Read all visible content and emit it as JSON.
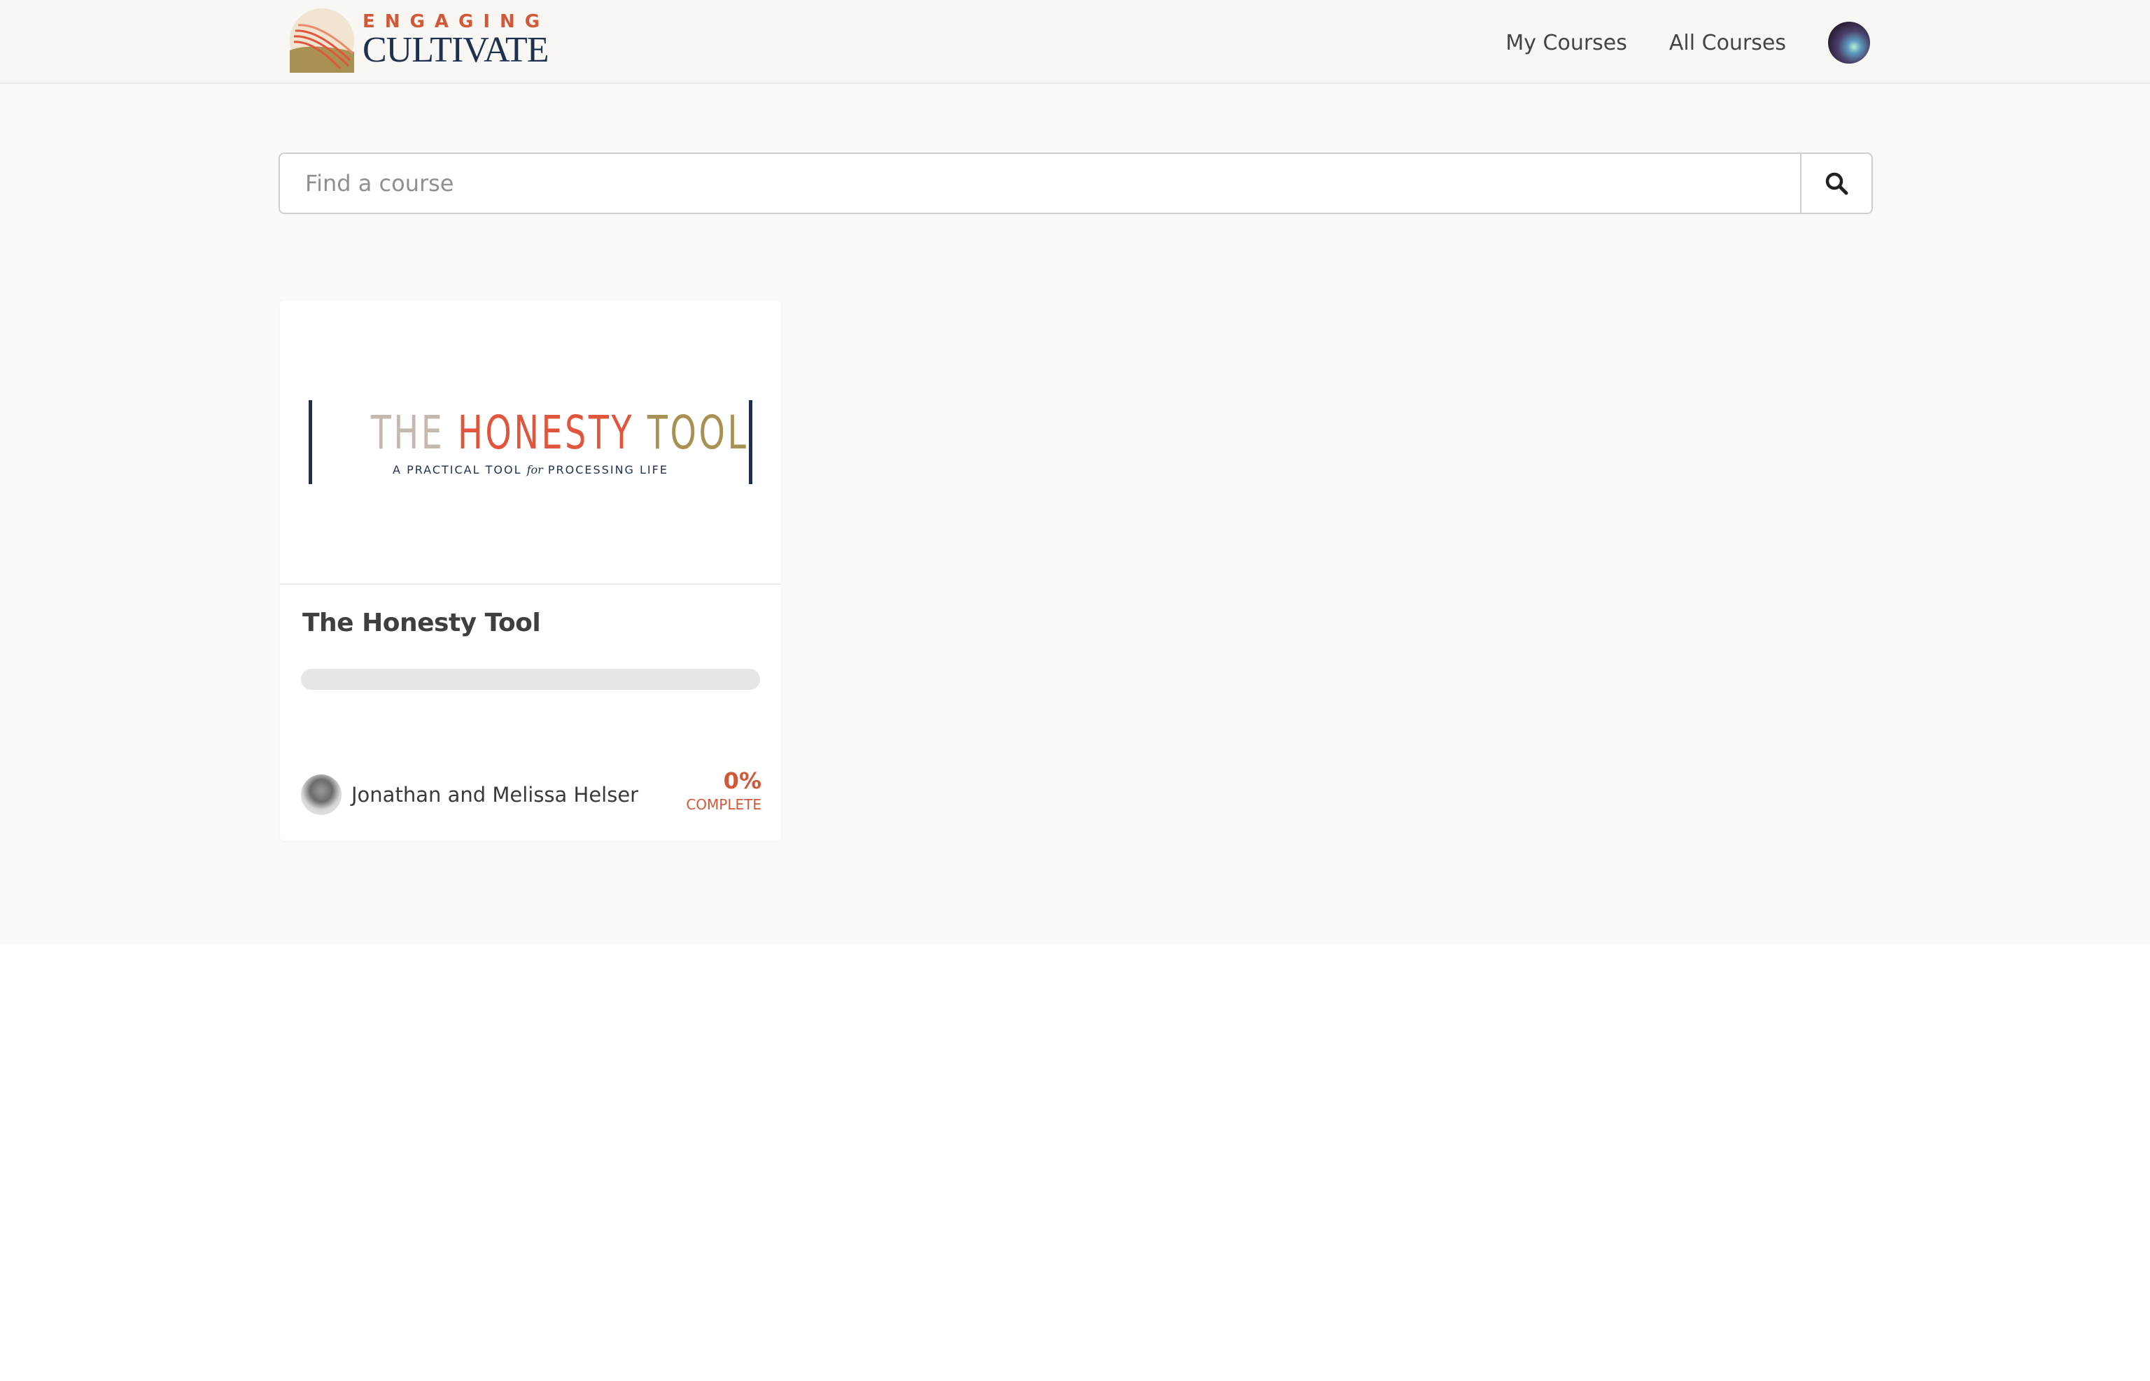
{
  "brand": {
    "name_top": "ENGAGING",
    "name_bottom": "CULTIVATE",
    "colors": {
      "accent": "#d1593a",
      "navy": "#1f3150",
      "gold": "#a89152"
    }
  },
  "nav": {
    "my_courses": "My Courses",
    "all_courses": "All Courses",
    "avatar_icon": "user-avatar"
  },
  "search": {
    "placeholder": "Find a course",
    "value": "",
    "icon": "search-icon"
  },
  "courses": [
    {
      "cover": {
        "the": "THE",
        "honesty": "HONESTY",
        "tool": "TOOL",
        "subtitle_before": "A PRACTICAL TOOL",
        "subtitle_for": "for",
        "subtitle_after": "PROCESSING LIFE"
      },
      "title": "The Honesty Tool",
      "progress_fraction": 0,
      "author": "Jonathan and Melissa Helser",
      "percent": "0%",
      "percent_label": "COMPLETE"
    }
  ]
}
